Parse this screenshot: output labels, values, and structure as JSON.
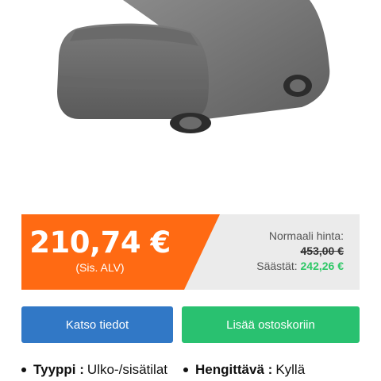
{
  "price": {
    "current": "210,74 €",
    "vat_note": "(Sis. ALV)",
    "normal_label": "Normaali hinta:",
    "normal_value": "453,00 €",
    "savings_label": "Säästät:",
    "savings_value": "242,26 €"
  },
  "buttons": {
    "details_label": "Katso tiedot",
    "cart_label": "Lisää ostoskoriin"
  },
  "features": [
    {
      "key": "Tyyppi :",
      "value": "Ulko-/sisätilat"
    },
    {
      "key": "Hengittävä :",
      "value": "Kyllä"
    }
  ],
  "colors": {
    "accent_orange": "#ff6a13",
    "button_blue": "#3178c6",
    "button_green": "#29c170",
    "savings_green": "#2ec866"
  }
}
